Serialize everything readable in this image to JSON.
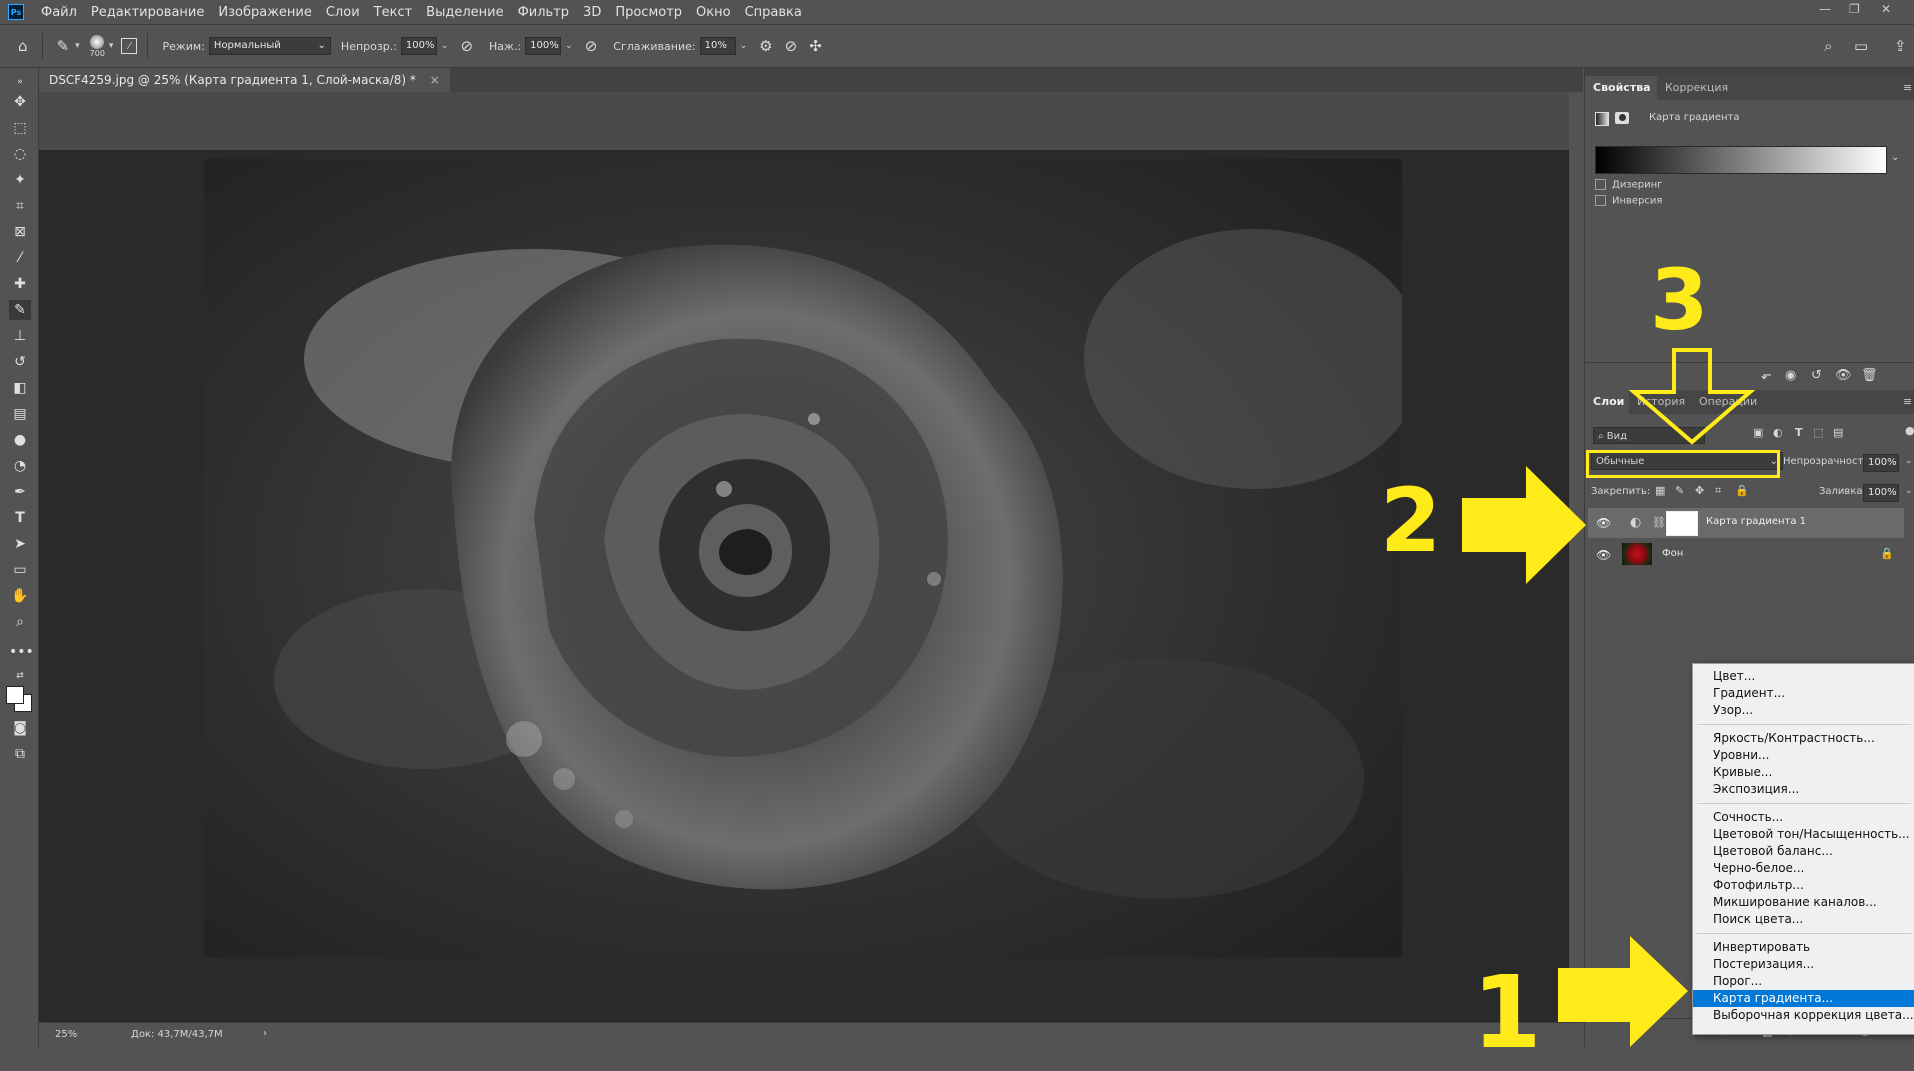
{
  "menubar": {
    "app_icon": "Ps",
    "items": [
      "Файл",
      "Редактирование",
      "Изображение",
      "Слои",
      "Текст",
      "Выделение",
      "Фильтр",
      "3D",
      "Просмотр",
      "Окно",
      "Справка"
    ]
  },
  "options_bar": {
    "brush_size": "700",
    "mode_label": "Режим:",
    "mode_value": "Нормальный",
    "opacity_label": "Непрозр.:",
    "opacity_value": "100%",
    "pressure_label": "Наж.:",
    "pressure_value": "100%",
    "smoothing_label": "Сглаживание:",
    "smoothing_value": "10%"
  },
  "document": {
    "tab_title": "DSCF4259.jpg @ 25% (Карта градиента 1, Слой-маска/8) *",
    "zoom": "25%",
    "doc_info": "Док: 43,7M/43,7M"
  },
  "properties_panel": {
    "tabs": [
      "Свойства",
      "Коррекция"
    ],
    "layer_type": "Карта градиента",
    "dithering_label": "Дизеринг",
    "reverse_label": "Инверсия"
  },
  "layers_panel": {
    "tabs": [
      "Слои",
      "История",
      "Операции"
    ],
    "filter_label": "Вид",
    "blend_mode": "Обычные",
    "opacity_label": "Непрозрачность:",
    "opacity_value": "100%",
    "lock_label": "Закрепить:",
    "fill_label": "Заливка:",
    "fill_value": "100%",
    "layers": [
      {
        "name": "Карта градиента 1",
        "visible": true,
        "selected": true
      },
      {
        "name": "Фон",
        "visible": true,
        "locked": true
      }
    ]
  },
  "adjustment_menu": {
    "groups": [
      [
        "Цвет...",
        "Градиент...",
        "Узор..."
      ],
      [
        "Яркость/Контрастность...",
        "Уровни...",
        "Кривые...",
        "Экспозиция..."
      ],
      [
        "Сочность...",
        "Цветовой тон/Насыщенность...",
        "Цветовой баланс...",
        "Черно-белое...",
        "Фотофильтр...",
        "Микширование каналов...",
        "Поиск цвета..."
      ],
      [
        "Инвертировать",
        "Постеризация...",
        "Порог...",
        "Карта градиента...",
        "Выборочная коррекция цвета..."
      ]
    ],
    "selected": "Карта градиента..."
  },
  "annotations": {
    "num1": "1",
    "num2": "2",
    "num3": "3",
    "color": "#ffeb1a"
  },
  "colors": {
    "ui_bg": "#535353",
    "canvas_bg": "#282828",
    "menu_highlight": "#0078d7"
  }
}
